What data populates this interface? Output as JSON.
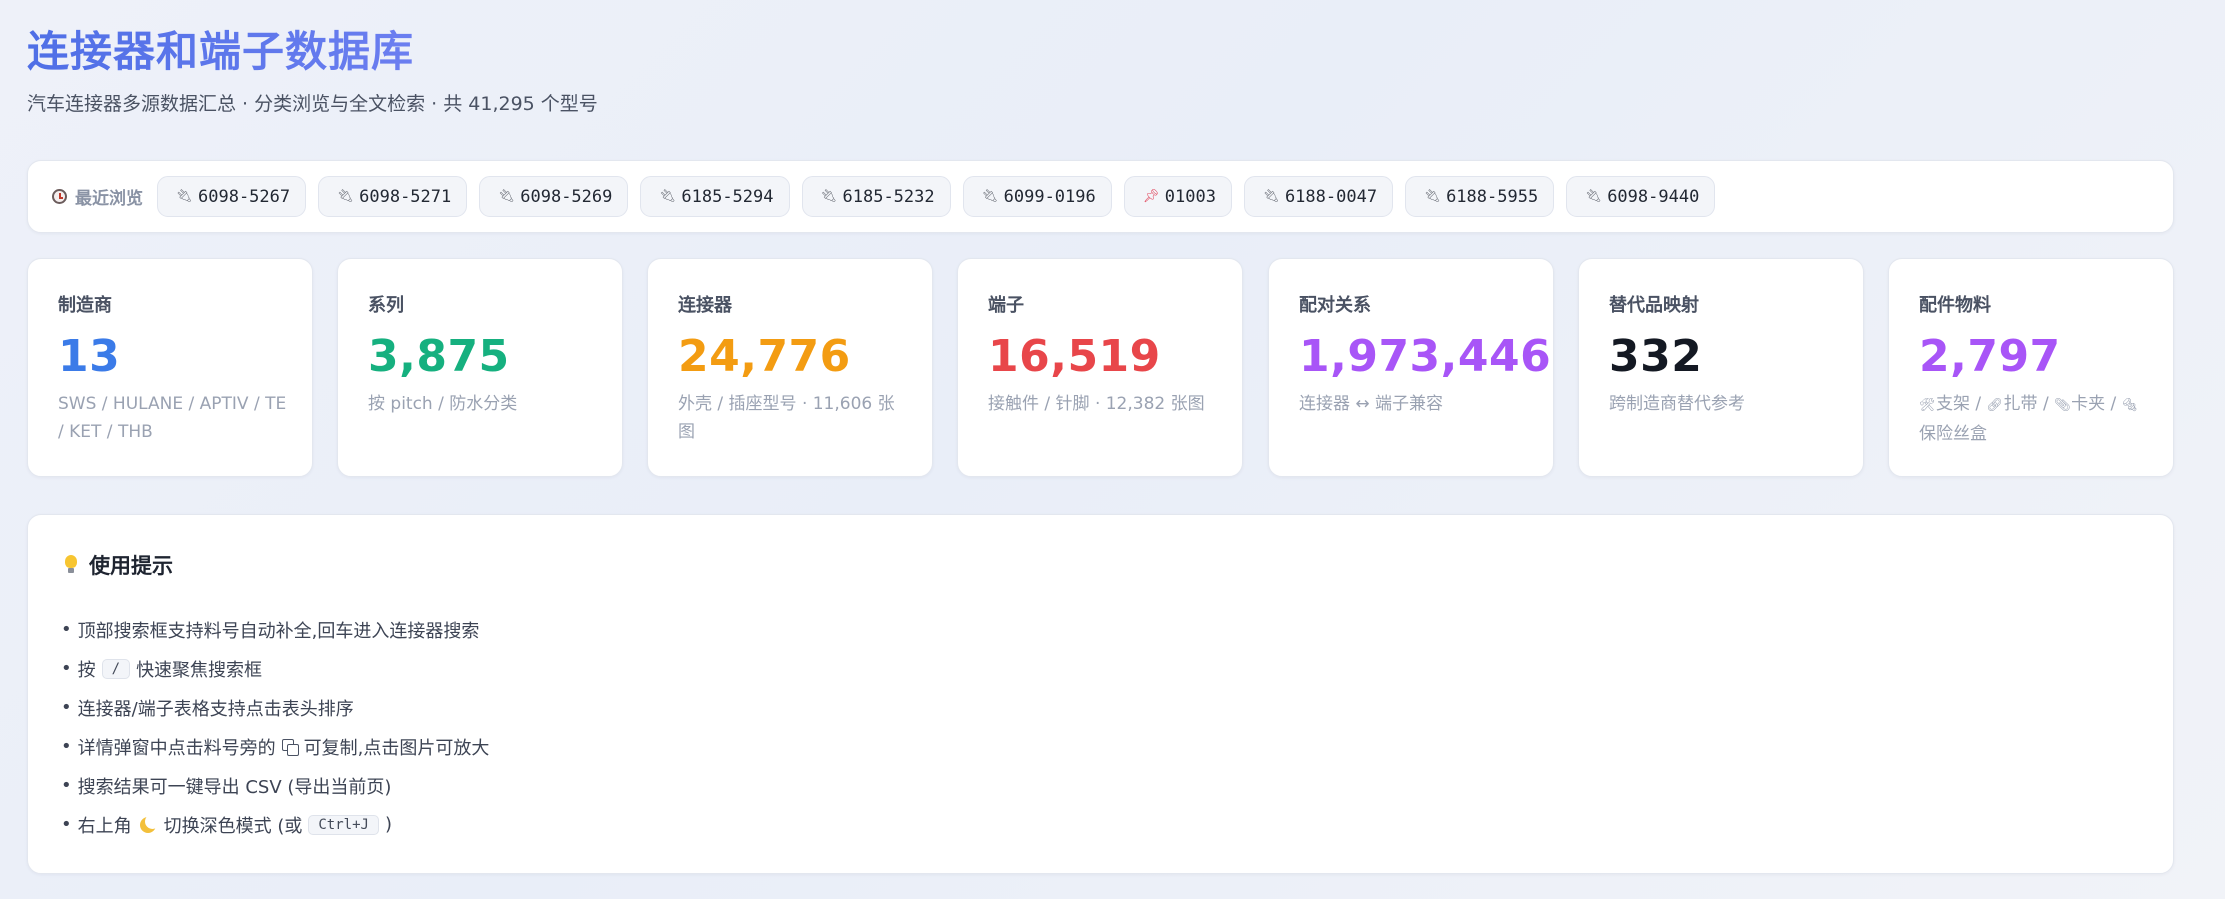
{
  "header": {
    "title": "连接器和端子数据库",
    "subtitle": "汽车连接器多源数据汇总 · 分类浏览与全文检索 · 共 41,295 个型号"
  },
  "recent": {
    "label": "最近浏览",
    "items": [
      {
        "code": "6098-5267",
        "icon": "plug-icon"
      },
      {
        "code": "6098-5271",
        "icon": "plug-icon"
      },
      {
        "code": "6098-5269",
        "icon": "plug-icon"
      },
      {
        "code": "6185-5294",
        "icon": "plug-icon"
      },
      {
        "code": "6185-5232",
        "icon": "plug-icon"
      },
      {
        "code": "6099-0196",
        "icon": "plug-icon"
      },
      {
        "code": "01003",
        "icon": "pushpin-icon"
      },
      {
        "code": "6188-0047",
        "icon": "plug-icon"
      },
      {
        "code": "6188-5955",
        "icon": "plug-icon"
      },
      {
        "code": "6098-9440",
        "icon": "plug-icon"
      }
    ]
  },
  "stats": [
    {
      "label": "制造商",
      "value": "13",
      "desc": "SWS / HULANE / APTIV / TE / KET / THB",
      "color": "#3b7be8"
    },
    {
      "label": "系列",
      "value": "3,875",
      "desc": "按 pitch / 防水分类",
      "color": "#16b07f"
    },
    {
      "label": "连接器",
      "value": "24,776",
      "desc": "外壳 / 插座型号 · 11,606 张图",
      "color": "#f39c12"
    },
    {
      "label": "端子",
      "value": "16,519",
      "desc": "接触件 / 针脚 · 12,382 张图",
      "color": "#e8464a"
    },
    {
      "label": "配对关系",
      "value": "1,973,446",
      "desc": "连接器 ↔ 端子兼容",
      "color": "#a855f7"
    },
    {
      "label": "替代品映射",
      "value": "332",
      "desc": "跨制造商替代参考",
      "color": "#141923"
    },
    {
      "label": "配件物料",
      "value": "2,797",
      "desc_parts": [
        "支架 /",
        "扎带 /",
        "卡夹",
        "/",
        "保险丝盒"
      ],
      "color": "#a855f7"
    }
  ],
  "tips": {
    "title": "使用提示",
    "bullet": "•",
    "line1": "顶部搜索框支持料号自动补全,回车进入连接器搜索",
    "line2_pre": "按",
    "line2_key": "/",
    "line2_post": "快速聚焦搜索框",
    "line3": "连接器/端子表格支持点击表头排序",
    "line4_pre": "详情弹窗中点击料号旁的",
    "line4_post": "可复制,点击图片可放大",
    "line5": "搜索结果可一键导出 CSV (导出当前页)",
    "line6_pre": "右上角",
    "line6_mid": "切换深色模式 (或",
    "line6_key": "Ctrl+J",
    "line6_post": ")"
  }
}
